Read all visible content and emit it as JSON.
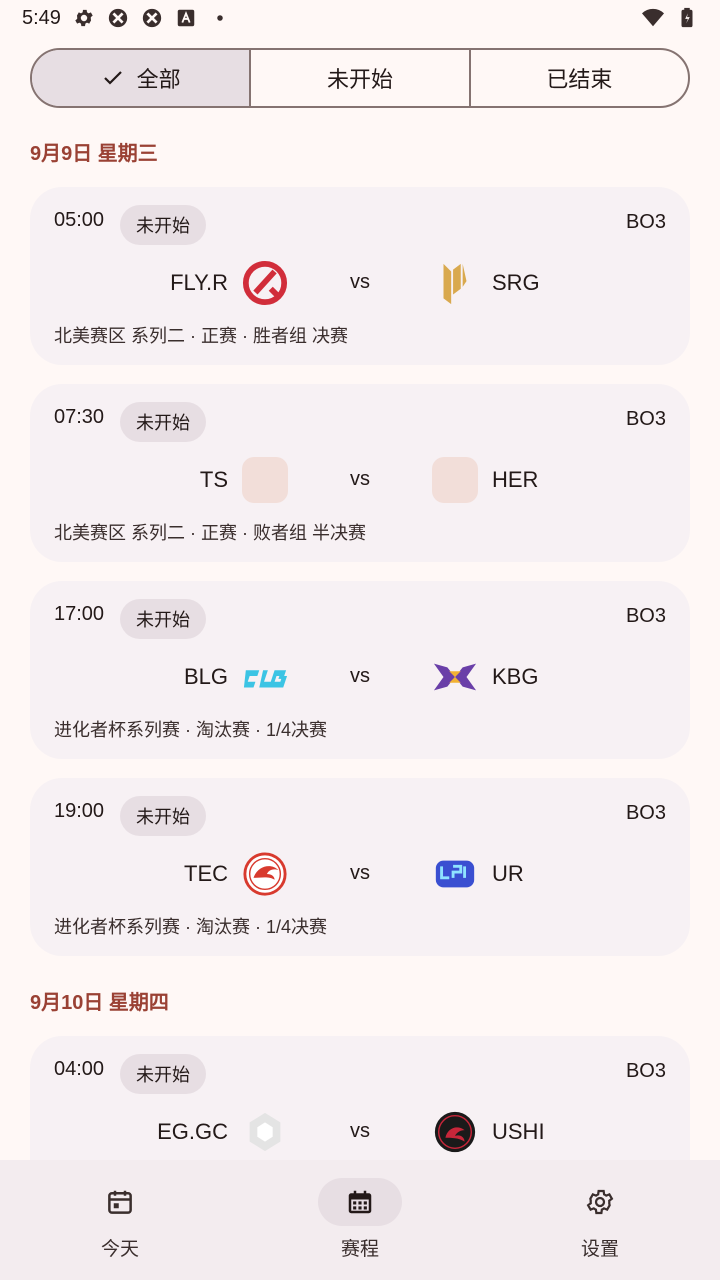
{
  "status_bar": {
    "time": "5:49"
  },
  "filter": {
    "segments": [
      {
        "label": "全部",
        "selected": true
      },
      {
        "label": "未开始",
        "selected": false
      },
      {
        "label": "已结束",
        "selected": false
      }
    ]
  },
  "days": [
    {
      "date": "9月9日 星期三",
      "matches": [
        {
          "time": "05:00",
          "status": "未开始",
          "format": "BO3",
          "team_a": "FLY.R",
          "team_b": "SRG",
          "desc": "北美赛区 系列二 · 正赛 · 胜者组 决赛"
        },
        {
          "time": "07:30",
          "status": "未开始",
          "format": "BO3",
          "team_a": "TS",
          "team_b": "HER",
          "desc": "北美赛区 系列二 · 正赛 · 败者组 半决赛"
        },
        {
          "time": "17:00",
          "status": "未开始",
          "format": "BO3",
          "team_a": "BLG",
          "team_b": "KBG",
          "desc": "进化者杯系列赛 · 淘汰赛 · 1/4决赛"
        },
        {
          "time": "19:00",
          "status": "未开始",
          "format": "BO3",
          "team_a": "TEC",
          "team_b": "UR",
          "desc": "进化者杯系列赛 · 淘汰赛 · 1/4决赛"
        }
      ]
    },
    {
      "date": "9月10日 星期四",
      "matches": [
        {
          "time": "04:00",
          "status": "未开始",
          "format": "BO3",
          "team_a": "EG.GC",
          "team_b": "USHI",
          "desc": ""
        }
      ]
    }
  ],
  "vs_label": "vs",
  "nav": {
    "items": [
      {
        "label": "今天",
        "icon": "calendar-today-icon",
        "active": false
      },
      {
        "label": "赛程",
        "icon": "calendar-month-icon",
        "active": true
      },
      {
        "label": "设置",
        "icon": "gear-icon",
        "active": false
      }
    ]
  },
  "colors": {
    "accent": "#9A4134",
    "background": "#FFF8F6",
    "card": "#F7F1F4",
    "chip": "#E7DEE3"
  }
}
